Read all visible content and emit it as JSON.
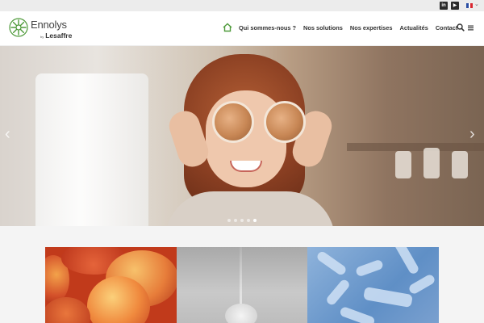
{
  "topbar": {
    "social": [
      {
        "name": "linkedin-icon",
        "label": "in"
      },
      {
        "name": "youtube-icon",
        "label": "▶"
      }
    ],
    "language_flag": "fr-flag"
  },
  "header": {
    "logo": {
      "name": "Ennolys",
      "by": "by",
      "parent": "Lesaffre"
    },
    "nav": [
      {
        "label": "Qui sommes-nous ?"
      },
      {
        "label": "Nos solutions"
      },
      {
        "label": "Nos expertises"
      },
      {
        "label": "Actualités"
      },
      {
        "label": "Contact"
      }
    ],
    "colors": {
      "brand_green": "#4e9a3a",
      "nav_text": "#333333"
    }
  },
  "hero": {
    "slides_count": 5,
    "active_slide": 5
  }
}
